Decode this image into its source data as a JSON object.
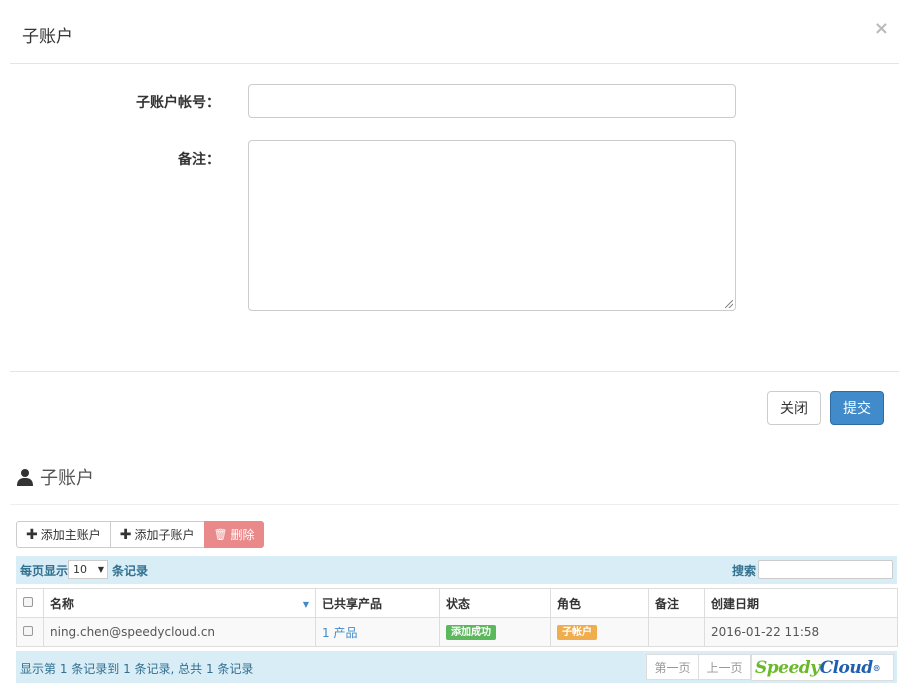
{
  "modal": {
    "title": "子账户",
    "close_glyph": "×",
    "fields": {
      "account_label": "子账户帐号：",
      "account_value": "",
      "remark_label": "备注：",
      "remark_value": ""
    },
    "buttons": {
      "close": "关闭",
      "submit": "提交"
    }
  },
  "section": {
    "title": "子账户",
    "icon": "user-icon"
  },
  "toolbar": {
    "add_main": "添加主账户",
    "add_sub": "添加子账户",
    "delete": "删除"
  },
  "table_controls": {
    "per_page_prefix": "每页显示",
    "per_page_value": "10",
    "per_page_suffix": "条记录",
    "search_label": "搜索",
    "search_value": ""
  },
  "table": {
    "headers": [
      "名称",
      "已共享产品",
      "状态",
      "角色",
      "备注",
      "创建日期"
    ],
    "rows": [
      {
        "name": "ning.chen@speedycloud.cn",
        "shared": "1 产品",
        "status": "添加成功",
        "role": "子帐户",
        "remark": "",
        "created": "2016-01-22 11:58"
      }
    ]
  },
  "pagination": {
    "info": "显示第 1 条记录到 1 条记录, 总共 1 条记录",
    "first": "第一页",
    "prev": "上一页",
    "logo_part1": "Speedy",
    "logo_part2": "Cloud",
    "logo_mark": "®"
  },
  "colors": {
    "primary": "#428bca",
    "danger": "#e9898a",
    "info_bar": "#d9edf7",
    "status_success": "#5cb85c",
    "role_warning": "#f0ad4e"
  }
}
